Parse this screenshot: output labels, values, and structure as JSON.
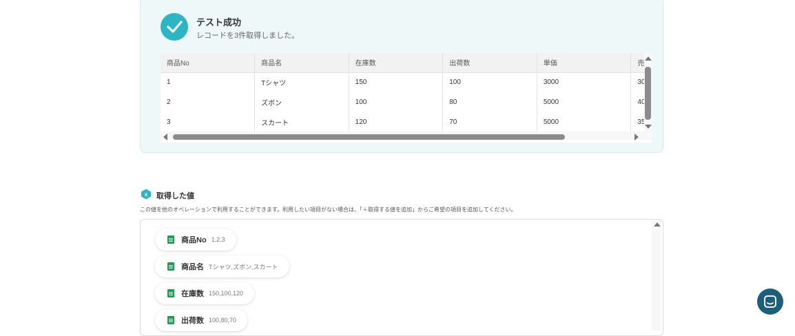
{
  "test": {
    "title": "テスト成功",
    "subtitle": "レコードを3件取得しました。"
  },
  "table": {
    "headers": [
      "商品No",
      "商品名",
      "在庫数",
      "出荷数",
      "単価",
      "売"
    ],
    "rows": [
      [
        "1",
        "Tシャツ",
        "150",
        "100",
        "3000",
        "30"
      ],
      [
        "2",
        "ズボン",
        "100",
        "80",
        "5000",
        "40"
      ],
      [
        "3",
        "スカート",
        "120",
        "70",
        "5000",
        "35"
      ]
    ]
  },
  "section": {
    "title": "取得した値",
    "description": "この値を他のオペレーションで利用することができます。利用したい項目がない場合は、「＋取得する値を追加」からご希望の項目を追加してください。"
  },
  "values": [
    {
      "label": "商品No",
      "value": "1,2,3"
    },
    {
      "label": "商品名",
      "value": "Tシャツ,ズボン,スカート"
    },
    {
      "label": "在庫数",
      "value": "150,100,120"
    },
    {
      "label": "出荷数",
      "value": "100,80,70"
    }
  ],
  "colors": {
    "accent": "#2bb5c5",
    "sheet_green": "#1e9e50",
    "chat_button": "#1c5f7d"
  },
  "icons": {
    "success": "check-icon",
    "section": "variable-icon",
    "value": "spreadsheet-icon",
    "chat": "chat-icon"
  }
}
